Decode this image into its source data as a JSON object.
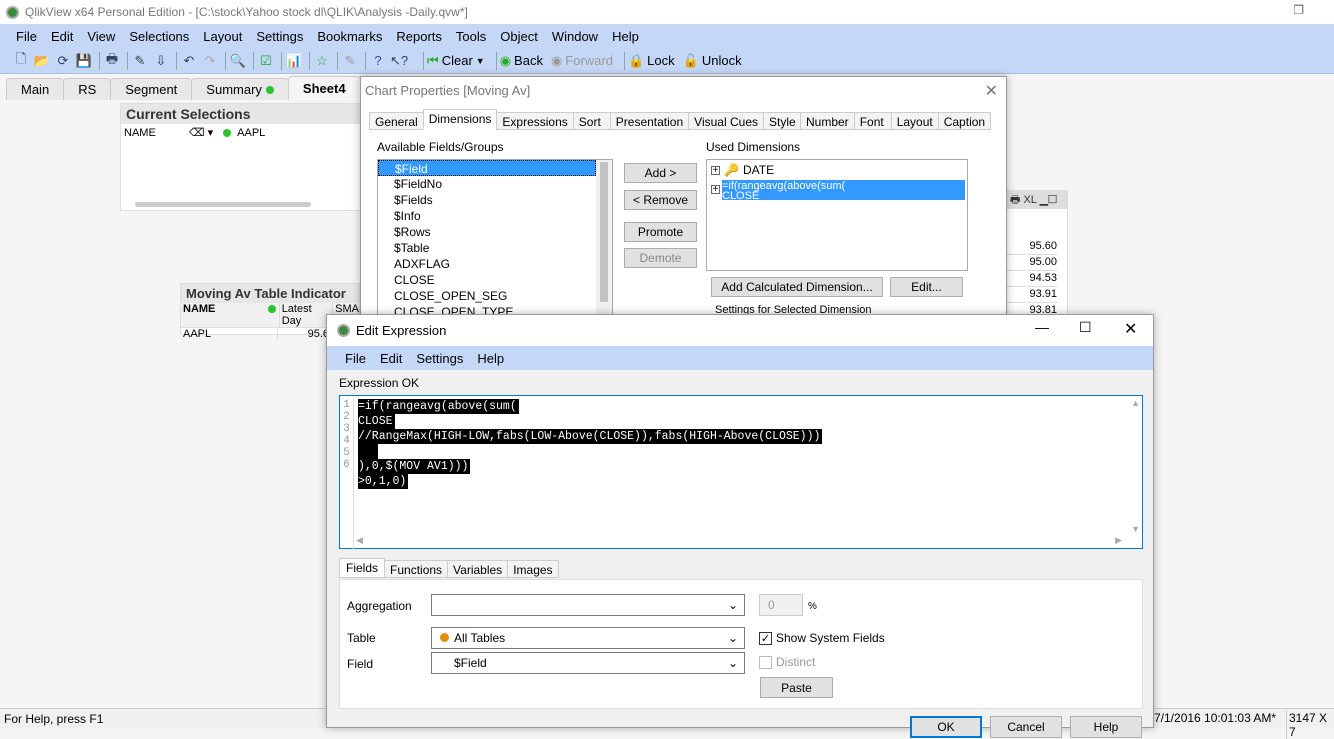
{
  "window": {
    "title": "QlikView x64 Personal Edition - [C:\\stock\\Yahoo stock dl\\QLIK\\Analysis -Daily.qvw*]"
  },
  "menu": [
    "File",
    "Edit",
    "View",
    "Selections",
    "Layout",
    "Settings",
    "Bookmarks",
    "Reports",
    "Tools",
    "Object",
    "Window",
    "Help"
  ],
  "toolbar": {
    "clear": "Clear",
    "back": "Back",
    "forward": "Forward",
    "lock": "Lock",
    "unlock": "Unlock"
  },
  "sheet_tabs": [
    {
      "label": "Main"
    },
    {
      "label": "RS"
    },
    {
      "label": "Segment"
    },
    {
      "label": "Summary"
    },
    {
      "label": "Sheet4",
      "active": true
    }
  ],
  "current_selections": {
    "title": "Current Selections",
    "field": "NAME",
    "value": "AAPL"
  },
  "moving_av_table": {
    "title": "Moving Av Table Indicator",
    "columns": [
      "NAME",
      "Latest Day",
      "SMA"
    ],
    "rows": [
      [
        "AAPL",
        "95.6"
      ]
    ]
  },
  "right_table": {
    "header_icons": [
      "XL"
    ],
    "values": [
      "95.60",
      "95.00",
      "94.53",
      "93.91",
      "93.81"
    ]
  },
  "chart_properties": {
    "title": "Chart Properties [Moving Av]",
    "tabs": [
      "General",
      "Dimensions",
      "Expressions",
      "Sort",
      "Presentation",
      "Visual Cues",
      "Style",
      "Number",
      "Font",
      "Layout",
      "Caption"
    ],
    "active_tab": "Dimensions",
    "available_label": "Available Fields/Groups",
    "available": [
      "$Field",
      "$FieldNo",
      "$Fields",
      "$Info",
      "$Rows",
      "$Table",
      "ADXFLAG",
      "CLOSE",
      "CLOSE_OPEN_SEG",
      "CLOSE_OPEN_TYPE"
    ],
    "buttons": {
      "add": "Add >",
      "remove": "< Remove",
      "promote": "Promote",
      "demote": "Demote",
      "add_calc": "Add Calculated Dimension...",
      "edit": "Edit..."
    },
    "used_label": "Used Dimensions",
    "used": [
      "DATE",
      "=if(rangeavg(above(sum(\nCLOSE"
    ],
    "settings_label": "Settings for Selected Dimension"
  },
  "edit_expression": {
    "title": "Edit Expression",
    "menu": [
      "File",
      "Edit",
      "Settings",
      "Help"
    ],
    "status": "Expression OK",
    "lines": [
      "=if(rangeavg(above(sum(",
      "CLOSE",
      "//RangeMax(HIGH-LOW,fabs(LOW-Above(CLOSE)),fabs(HIGH-Above(CLOSE)))",
      "",
      "),0,$(MOV AV1)))",
      ">0,1,0)"
    ],
    "tabs": [
      "Fields",
      "Functions",
      "Variables",
      "Images"
    ],
    "aggregation_label": "Aggregation",
    "aggregation_value": "",
    "count_value": "0",
    "percent": "%",
    "table_label": "Table",
    "table_value": "All Tables",
    "field_label": "Field",
    "field_value": "$Field",
    "show_system_fields": "Show System Fields",
    "show_system_checked": true,
    "distinct": "Distinct",
    "paste": "Paste",
    "ok": "OK",
    "cancel": "Cancel",
    "help": "Help"
  },
  "statusbar": {
    "help": "For Help, press F1",
    "datetime": "7/1/2016 10:01:03 AM*",
    "size": "3147 X 7"
  }
}
